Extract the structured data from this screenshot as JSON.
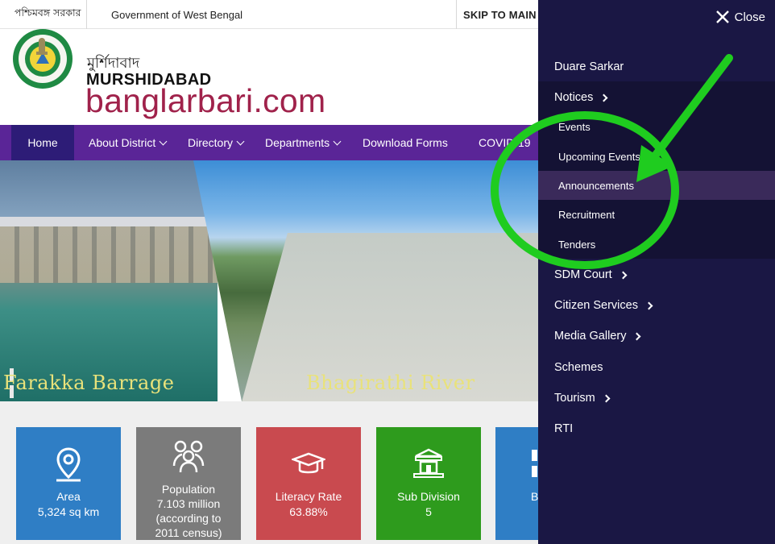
{
  "topbar": {
    "bengali_gov": "পশ্চিমবঙ্গ সরকার",
    "gov": "Government of West Bengal",
    "skip": "SKIP TO MAIN C"
  },
  "header": {
    "district_bn": "মুর্শিদাবাদ",
    "district": "MURSHIDABAD",
    "domain": "banglarbari.com"
  },
  "nav": [
    {
      "label": "Home"
    },
    {
      "label": "About District"
    },
    {
      "label": "Directory"
    },
    {
      "label": "Departments"
    },
    {
      "label": "Download Forms"
    },
    {
      "label": "COVID-19"
    }
  ],
  "hero": {
    "slides": [
      {
        "caption": "Farakka Barrage"
      },
      {
        "caption": "Bhagirathi River"
      }
    ]
  },
  "stats": [
    {
      "title": "Area",
      "value": "5,324 sq km",
      "icon": "map-pin-icon"
    },
    {
      "title": "Population",
      "value": "7.103 million",
      "extra1": "(according to",
      "extra2": "2011 census)",
      "icon": "people-icon"
    },
    {
      "title": "Literacy Rate",
      "value": "63.88%",
      "icon": "graduation-cap-icon"
    },
    {
      "title": "Sub Division",
      "value": "5",
      "icon": "building-icon"
    },
    {
      "title": "B",
      "icon": "block-icon"
    }
  ],
  "drawer": {
    "close_label": "Close",
    "items": [
      {
        "label": "Duare Sarkar"
      },
      {
        "label": "Notices"
      },
      {
        "label": "SDM Court"
      },
      {
        "label": "Citizen Services"
      },
      {
        "label": "Media Gallery"
      },
      {
        "label": "Schemes"
      },
      {
        "label": "Tourism"
      },
      {
        "label": "RTI"
      }
    ],
    "notices_sub": [
      {
        "label": "Events"
      },
      {
        "label": "Upcoming Events"
      },
      {
        "label": "Announcements"
      },
      {
        "label": "Recruitment"
      },
      {
        "label": "Tenders"
      }
    ]
  },
  "colors": {
    "nav": "#5a2597",
    "nav_active": "#2d1c77",
    "drawer": "#1a1744",
    "brand": "#a0224b",
    "annotation": "#1fcc1f"
  }
}
